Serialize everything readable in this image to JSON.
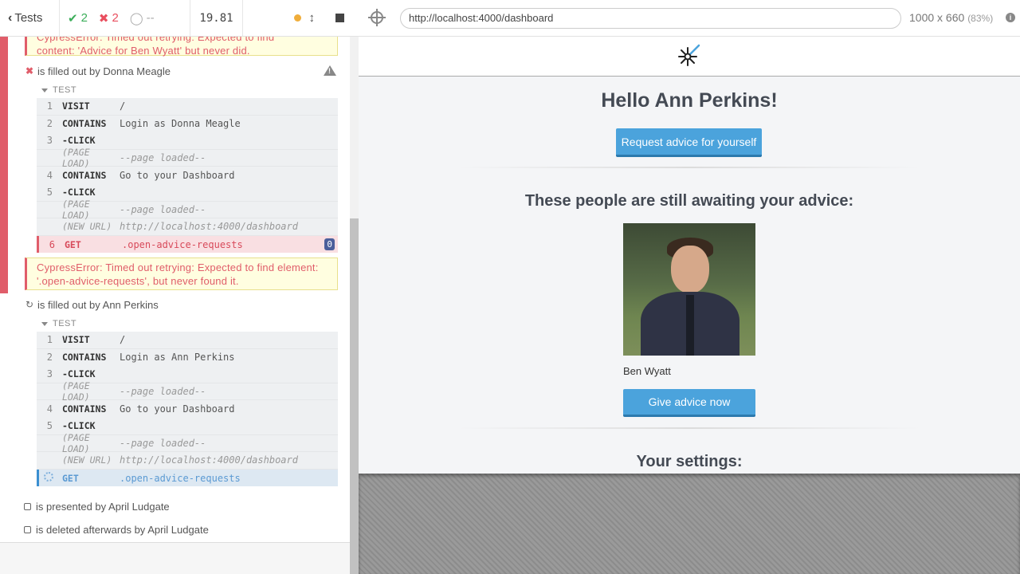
{
  "header": {
    "tests_label": "Tests",
    "passed": "2",
    "failed": "2",
    "pending": "--",
    "duration": "19.81"
  },
  "errors": {
    "top_error_partial": "CypressError: Timed out retrying: Expected to find",
    "top_error_tail": "content: 'Advice for Ben Wyatt' but never did.",
    "donna_error": "CypressError: Timed out retrying: Expected to find element: '.open-advice-requests', but never found it."
  },
  "tests": [
    {
      "title": "is filled out by Donna Meagle",
      "state": "failed",
      "section": "TEST",
      "commands": [
        {
          "num": "1",
          "name": "VISIT",
          "msg": "/"
        },
        {
          "num": "2",
          "name": "CONTAINS",
          "msg": "Login as Donna Meagle"
        },
        {
          "num": "3",
          "name": "-CLICK",
          "msg": ""
        },
        {
          "num": "",
          "name": "(PAGE LOAD)",
          "msg": "--page loaded--"
        },
        {
          "num": "4",
          "name": "CONTAINS",
          "msg": "Go to your Dashboard"
        },
        {
          "num": "5",
          "name": "-CLICK",
          "msg": ""
        },
        {
          "num": "",
          "name": "(PAGE LOAD)",
          "msg": "--page loaded--"
        },
        {
          "num": "",
          "name": "(NEW URL)",
          "msg": "http://localhost:4000/dashboard"
        },
        {
          "num": "6",
          "name": "GET",
          "msg": ".open-advice-requests",
          "badge": "0"
        }
      ]
    },
    {
      "title": "is filled out by Ann Perkins",
      "state": "running",
      "section": "TEST",
      "commands": [
        {
          "num": "1",
          "name": "VISIT",
          "msg": "/"
        },
        {
          "num": "2",
          "name": "CONTAINS",
          "msg": "Login as Ann Perkins"
        },
        {
          "num": "3",
          "name": "-CLICK",
          "msg": ""
        },
        {
          "num": "",
          "name": "(PAGE LOAD)",
          "msg": "--page loaded--"
        },
        {
          "num": "4",
          "name": "CONTAINS",
          "msg": "Go to your Dashboard"
        },
        {
          "num": "5",
          "name": "-CLICK",
          "msg": ""
        },
        {
          "num": "",
          "name": "(PAGE LOAD)",
          "msg": "--page loaded--"
        },
        {
          "num": "",
          "name": "(NEW URL)",
          "msg": "http://localhost:4000/dashboard"
        },
        {
          "num": "",
          "name": "GET",
          "msg": ".open-advice-requests"
        }
      ]
    },
    {
      "title": "is presented by April Ludgate",
      "state": "pending"
    },
    {
      "title": "is deleted afterwards by April Ludgate",
      "state": "pending"
    }
  ],
  "aut": {
    "url": "http://localhost:4000/dashboard",
    "viewport": "1000 x 660",
    "scale": "(83%)",
    "greeting": "Hello Ann Perkins!",
    "request_button": "Request advice for yourself",
    "awaiting_heading": "These people are still awaiting your advice:",
    "person_name": "Ben Wyatt",
    "give_advice_button": "Give advice now",
    "settings_heading": "Your settings:"
  },
  "colors": {
    "pass": "#3cae5a",
    "fail": "#e05d6a",
    "accent": "#4ba3dc",
    "running": "#3b8fd1"
  }
}
